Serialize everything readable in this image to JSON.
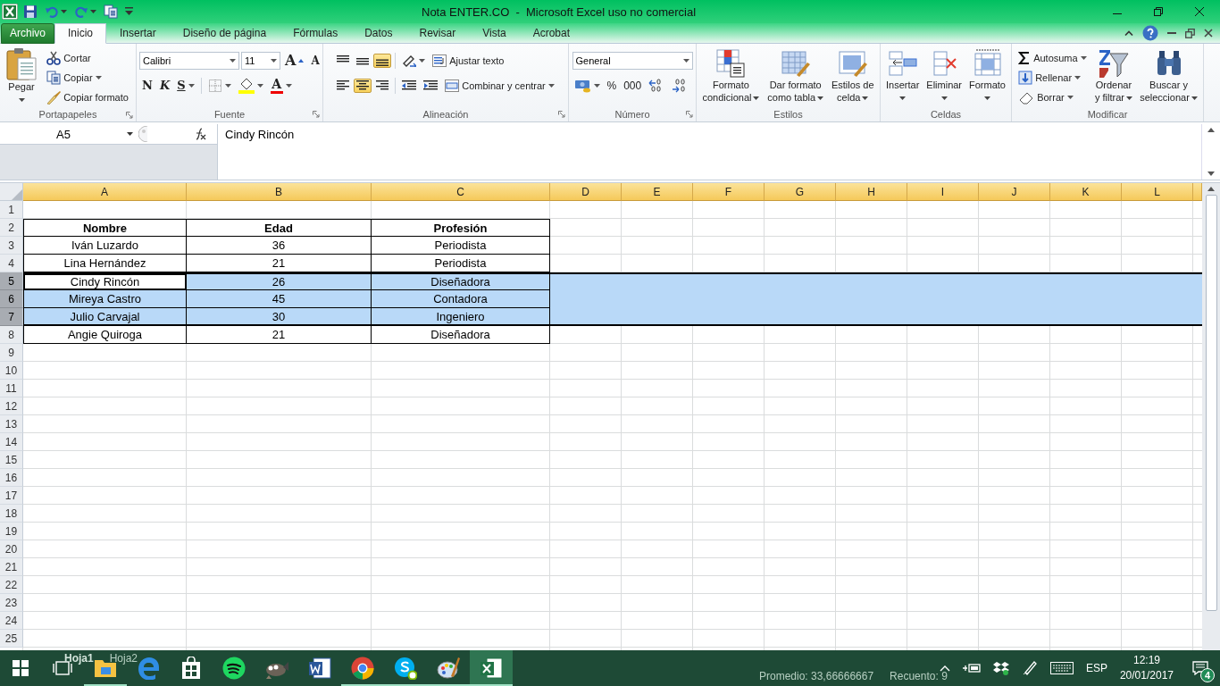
{
  "window": {
    "title": "Nota ENTER.CO  -  Microsoft Excel uso no comercial"
  },
  "quick_access": [
    {
      "kind": "save",
      "dropdown": false
    },
    {
      "kind": "undo",
      "dropdown": true
    },
    {
      "kind": "redo",
      "dropdown": true
    },
    {
      "kind": "copy",
      "dropdown": false
    },
    {
      "kind": "customize",
      "dropdown": false
    }
  ],
  "ribbon_tabs": [
    {
      "label": "Archivo",
      "kind": "file",
      "selected": false
    },
    {
      "label": "Inicio",
      "kind": "tab",
      "selected": true
    },
    {
      "label": "Insertar",
      "kind": "tab",
      "selected": false
    },
    {
      "label": "Diseño de página",
      "kind": "tab",
      "selected": false
    },
    {
      "label": "Fórmulas",
      "kind": "tab",
      "selected": false
    },
    {
      "label": "Datos",
      "kind": "tab",
      "selected": false
    },
    {
      "label": "Revisar",
      "kind": "tab",
      "selected": false
    },
    {
      "label": "Vista",
      "kind": "tab",
      "selected": false
    },
    {
      "label": "Acrobat",
      "kind": "tab",
      "selected": false
    }
  ],
  "ribbon_groups": [
    {
      "name": "Portapapeles",
      "launcher": true,
      "columns": [
        [
          {
            "kind": "paste",
            "lines": [
              "Pegar"
            ],
            "dropdown": true
          }
        ],
        [
          {
            "kind": "cut",
            "label": "Cortar",
            "dropdown": false
          },
          {
            "kind": "copy",
            "label": "Copiar",
            "dropdown": true
          },
          {
            "kind": "brush",
            "label": "Copiar formato",
            "dropdown": false
          }
        ]
      ]
    },
    {
      "name": "Fuente",
      "launcher": true,
      "tiers": [
        [
          {
            "kind": "field",
            "value": "Calibri",
            "dropdown": true
          },
          {
            "kind": "size-field",
            "value": "11",
            "dropdown": true
          },
          {
            "kind": "grow",
            "label": "A",
            "dropdown": false
          },
          {
            "kind": "shrink",
            "label": "A",
            "dropdown": false
          }
        ],
        [
          {
            "kind": "bold",
            "label": "N",
            "dropdown": false
          },
          {
            "kind": "italic",
            "label": "K",
            "dropdown": false
          },
          {
            "kind": "underline",
            "label": "S",
            "dropdown": true
          },
          {
            "kind": "borders",
            "dropdown": true
          },
          {
            "kind": "fill",
            "dropdown": true
          },
          {
            "kind": "fontcolor",
            "label": "A",
            "dropdown": true
          }
        ]
      ]
    },
    {
      "name": "Alineación",
      "launcher": true,
      "tiers": [
        [
          {
            "kind": "align-top",
            "selected": false
          },
          {
            "kind": "align-middle",
            "selected": false
          },
          {
            "kind": "align-bottom",
            "selected": true
          },
          {
            "kind": "orientation",
            "dropdown": true
          },
          {
            "kind": "wrap",
            "label": "Ajustar texto",
            "dropdown": false
          }
        ],
        [
          {
            "kind": "align-left",
            "selected": false
          },
          {
            "kind": "align-center",
            "selected": true
          },
          {
            "kind": "align-right",
            "selected": false
          },
          {
            "kind": "outdent",
            "dropdown": false
          },
          {
            "kind": "indent",
            "dropdown": false
          },
          {
            "kind": "merge",
            "label": "Combinar y centrar",
            "dropdown": true
          }
        ]
      ]
    },
    {
      "name": "Número",
      "launcher": true,
      "tiers": [
        [
          {
            "kind": "wide-field",
            "value": "General",
            "dropdown": true
          }
        ],
        [
          {
            "kind": "currency",
            "dropdown": true
          },
          {
            "kind": "text",
            "label": "%",
            "dropdown": false
          },
          {
            "kind": "text",
            "label": "000",
            "dropdown": false
          },
          {
            "kind": "inc-decimal",
            "dropdown": false
          },
          {
            "kind": "dec-decimal",
            "dropdown": false
          }
        ]
      ]
    },
    {
      "name": "Estilos",
      "launcher": false,
      "columns": [
        [
          {
            "kind": "cond-format",
            "lines": [
              "Formato",
              "condicional"
            ],
            "dropdown": true
          }
        ],
        [
          {
            "kind": "table-format",
            "lines": [
              "Dar formato",
              "como tabla"
            ],
            "dropdown": true
          }
        ],
        [
          {
            "kind": "cell-styles",
            "lines": [
              "Estilos de",
              "celda"
            ],
            "dropdown": true
          }
        ]
      ]
    },
    {
      "name": "Celdas",
      "launcher": false,
      "columns": [
        [
          {
            "kind": "insert",
            "lines": [
              "Insertar"
            ],
            "dropdown": true
          }
        ],
        [
          {
            "kind": "delete",
            "lines": [
              "Eliminar"
            ],
            "dropdown": true
          }
        ],
        [
          {
            "kind": "format",
            "lines": [
              "Formato"
            ],
            "dropdown": true
          }
        ]
      ]
    },
    {
      "name": "Modificar",
      "launcher": false,
      "columns": [
        [
          {
            "kind": "sum",
            "label": "Autosuma",
            "dropdown": true
          },
          {
            "kind": "fill-down",
            "label": "Rellenar",
            "dropdown": true
          },
          {
            "kind": "eraser",
            "label": "Borrar",
            "dropdown": true
          }
        ],
        [
          {
            "kind": "sort",
            "lines": [
              "Ordenar",
              "y filtrar"
            ],
            "dropdown": true
          }
        ],
        [
          {
            "kind": "binoculars",
            "lines": [
              "Buscar y",
              "seleccionar"
            ],
            "dropdown": true
          }
        ]
      ]
    }
  ],
  "formula_bar": {
    "name_box": "A5",
    "value": "Cindy Rincón"
  },
  "sheet": {
    "columns": [
      "A",
      "B",
      "C",
      "D",
      "E",
      "F",
      "G",
      "H",
      "I",
      "J",
      "K",
      "L"
    ],
    "rows": [
      {
        "number": "1",
        "selected": false,
        "kind": "empty"
      },
      {
        "number": "2",
        "selected": false,
        "kind": "header",
        "cells": [
          {
            "text": "Nombre",
            "active": false
          },
          {
            "text": "Edad",
            "active": false
          },
          {
            "text": "Profesión",
            "active": false
          }
        ]
      },
      {
        "number": "3",
        "selected": false,
        "kind": "data",
        "cells": [
          {
            "text": "Iván Luzardo",
            "active": false
          },
          {
            "text": "36",
            "active": false
          },
          {
            "text": "Periodista",
            "active": false
          }
        ]
      },
      {
        "number": "4",
        "selected": false,
        "kind": "data",
        "cells": [
          {
            "text": "Lina Hernández",
            "active": false
          },
          {
            "text": "21",
            "active": false
          },
          {
            "text": "Periodista",
            "active": false
          }
        ]
      },
      {
        "number": "5",
        "selected": true,
        "kind": "data",
        "cells": [
          {
            "text": "Cindy Rincón",
            "active": true
          },
          {
            "text": "26",
            "active": false
          },
          {
            "text": "Diseñadora",
            "active": false
          }
        ]
      },
      {
        "number": "6",
        "selected": true,
        "kind": "data",
        "cells": [
          {
            "text": "Mireya Castro",
            "active": false
          },
          {
            "text": "45",
            "active": false
          },
          {
            "text": "Contadora",
            "active": false
          }
        ]
      },
      {
        "number": "7",
        "selected": true,
        "kind": "data",
        "cells": [
          {
            "text": "Julio Carvajal",
            "active": false
          },
          {
            "text": "30",
            "active": false
          },
          {
            "text": "Ingeniero",
            "active": false
          }
        ]
      },
      {
        "number": "8",
        "selected": false,
        "kind": "data",
        "cells": [
          {
            "text": "Angie Quiroga",
            "active": false
          },
          {
            "text": "21",
            "active": false
          },
          {
            "text": "Diseñadora",
            "active": false
          }
        ]
      },
      {
        "number": "9",
        "selected": false,
        "kind": "empty"
      },
      {
        "number": "10",
        "selected": false,
        "kind": "empty"
      },
      {
        "number": "11",
        "selected": false,
        "kind": "empty"
      },
      {
        "number": "12",
        "selected": false,
        "kind": "empty"
      },
      {
        "number": "13",
        "selected": false,
        "kind": "empty"
      },
      {
        "number": "14",
        "selected": false,
        "kind": "empty"
      },
      {
        "number": "15",
        "selected": false,
        "kind": "empty"
      },
      {
        "number": "16",
        "selected": false,
        "kind": "empty"
      },
      {
        "number": "17",
        "selected": false,
        "kind": "empty"
      },
      {
        "number": "18",
        "selected": false,
        "kind": "empty"
      },
      {
        "number": "19",
        "selected": false,
        "kind": "empty"
      },
      {
        "number": "20",
        "selected": false,
        "kind": "empty"
      },
      {
        "number": "21",
        "selected": false,
        "kind": "empty"
      },
      {
        "number": "22",
        "selected": false,
        "kind": "empty"
      },
      {
        "number": "23",
        "selected": false,
        "kind": "empty"
      },
      {
        "number": "24",
        "selected": false,
        "kind": "empty"
      },
      {
        "number": "25",
        "selected": false,
        "kind": "empty"
      }
    ]
  },
  "sheet_tabs": [
    {
      "label": "Hoja1",
      "selected": true
    },
    {
      "label": "Hoja2",
      "selected": false
    }
  ],
  "status_bar": [
    "Promedio: 33,66666667",
    "Recuento: 9"
  ],
  "taskbar": {
    "apps": [
      {
        "kind": "explorer",
        "running": true,
        "selected": false
      },
      {
        "kind": "edge",
        "running": false,
        "selected": false
      },
      {
        "kind": "store",
        "running": false,
        "selected": false
      },
      {
        "kind": "spotify",
        "running": false,
        "selected": false
      },
      {
        "kind": "gimp",
        "running": false,
        "selected": false
      },
      {
        "kind": "word",
        "running": false,
        "selected": false
      },
      {
        "kind": "chrome",
        "running": true,
        "selected": false
      },
      {
        "kind": "skype",
        "running": true,
        "selected": false
      },
      {
        "kind": "paint",
        "running": true,
        "selected": false
      },
      {
        "kind": "excel",
        "running": true,
        "selected": true
      }
    ],
    "language": "ESP",
    "time": "12:19",
    "date": "20/01/2017",
    "notifications": "4"
  }
}
